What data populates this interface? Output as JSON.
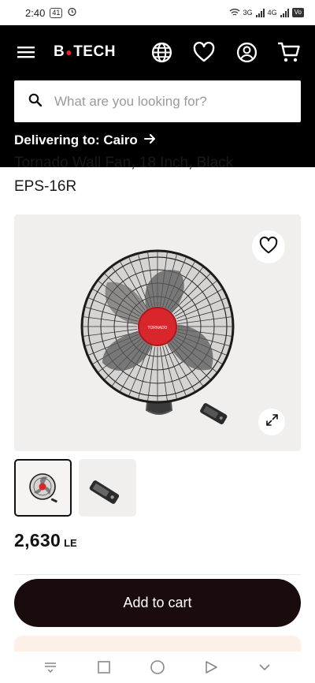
{
  "status_bar": {
    "time": "2:40",
    "badge": "41",
    "net1": "3G",
    "net2": "4G",
    "battery": "Vo"
  },
  "header": {
    "logo_left": "B",
    "logo_dot": "●",
    "logo_right": "TECH",
    "icons": [
      "menu-icon",
      "globe-icon",
      "heart-icon",
      "user-icon",
      "cart-icon"
    ]
  },
  "search": {
    "placeholder": "What are you looking for?"
  },
  "delivery": {
    "label": "Delivering to: Cairo"
  },
  "product": {
    "title_line1": "Tornado Wall Fan, 18 Inch, Black",
    "title_line2": "EPS-16R",
    "fan_brand": "TORNADO",
    "price_amount": "2,630",
    "price_currency": "LE",
    "thumbnails_count": 2
  },
  "actions": {
    "add_to_cart": "Add to cart"
  },
  "colors": {
    "header_bg": "#000000",
    "button_bg": "#1a0c0c",
    "accent_red": "#e6242c",
    "image_bg": "#f1efed"
  }
}
